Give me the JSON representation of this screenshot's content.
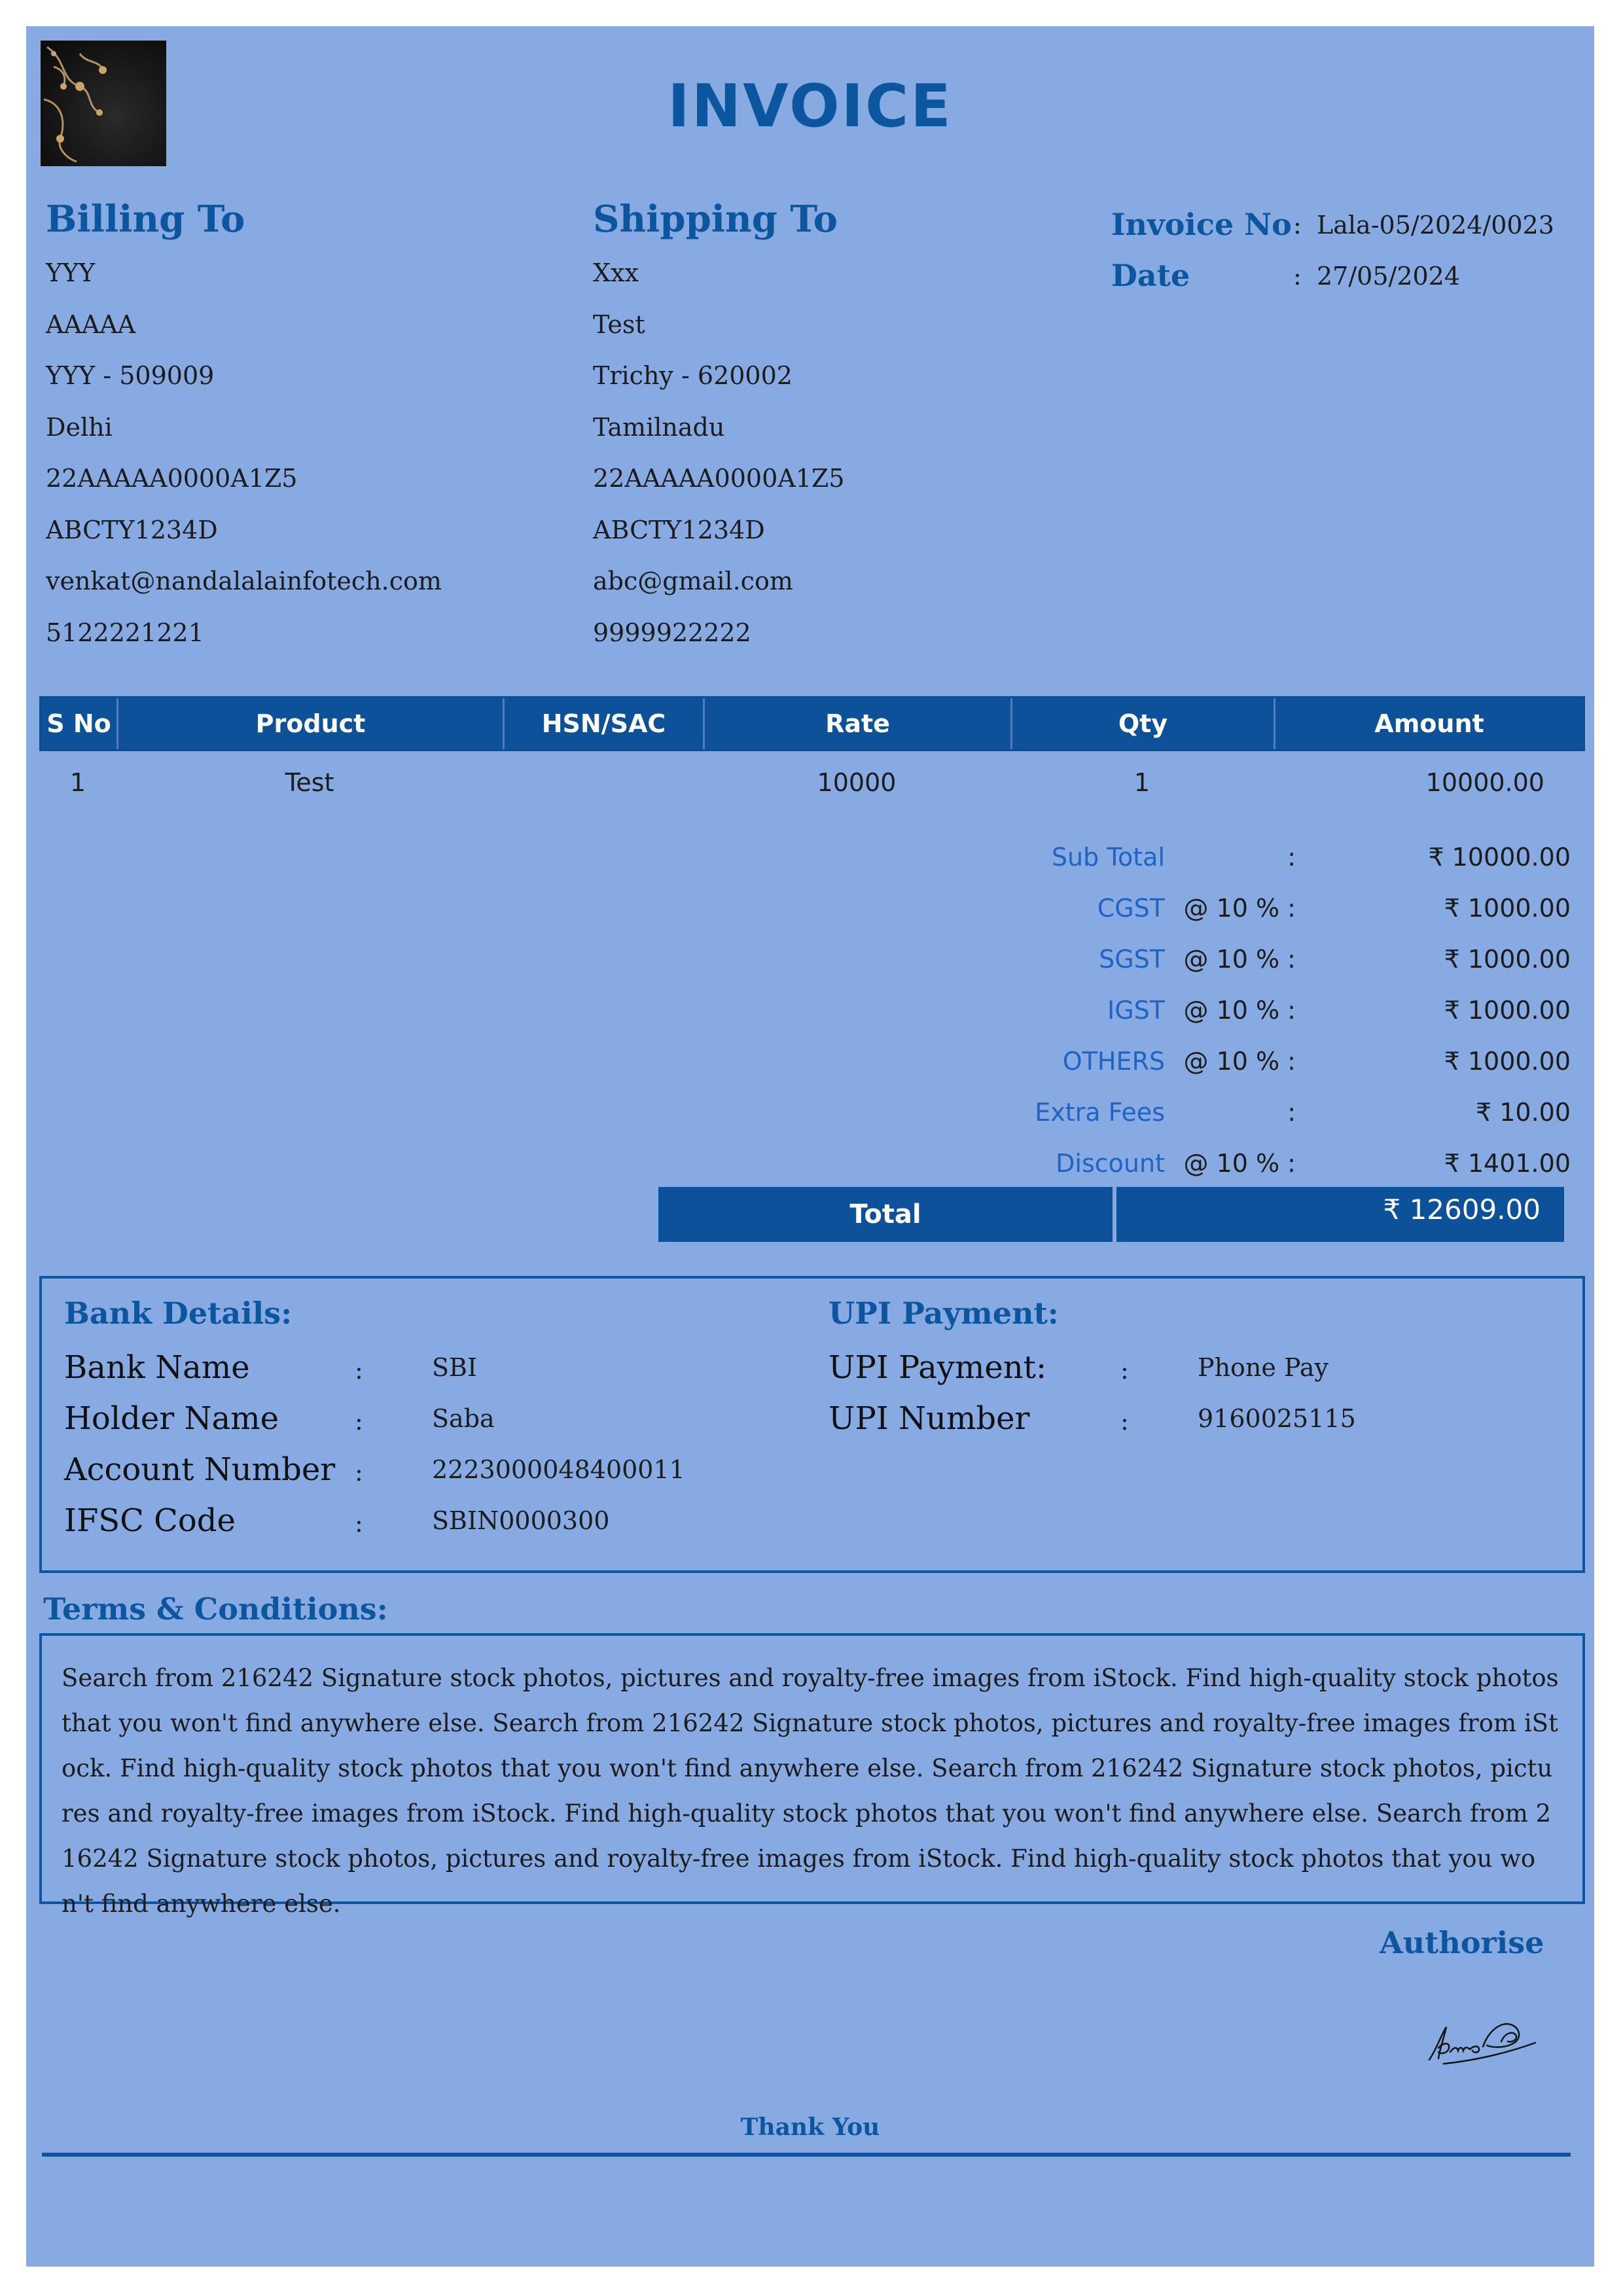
{
  "title": "INVOICE",
  "billing": {
    "heading": "Billing To",
    "lines": [
      "YYY",
      "AAAAA",
      "YYY - 509009",
      "Delhi",
      "22AAAAA0000A1Z5",
      "ABCTY1234D",
      "venkat@nandalalainfotech.com",
      "5122221221"
    ]
  },
  "shipping": {
    "heading": "Shipping To",
    "lines": [
      "Xxx",
      "Test",
      "Trichy - 620002",
      "Tamilnadu",
      "22AAAAA0000A1Z5",
      "ABCTY1234D",
      "abc@gmail.com",
      "9999922222"
    ]
  },
  "meta": {
    "invoice_no_label": "Invoice No",
    "invoice_no": "Lala-05/2024/0023",
    "date_label": "Date",
    "date": "27/05/2024",
    "colon": ":"
  },
  "table": {
    "headers": [
      "S No",
      "Product",
      "HSN/SAC",
      "Rate",
      "Qty",
      "Amount"
    ],
    "rows": [
      {
        "sno": "1",
        "product": "Test",
        "hsn": "",
        "rate": "10000",
        "qty": "1",
        "amount": "10000.00"
      }
    ]
  },
  "summary": [
    {
      "label": "Sub Total",
      "mid": ":",
      "value": "₹ 10000.00"
    },
    {
      "label": "CGST",
      "mid": "@ 10 % :",
      "value": "₹ 1000.00"
    },
    {
      "label": "SGST",
      "mid": "@ 10 % :",
      "value": "₹ 1000.00"
    },
    {
      "label": "IGST",
      "mid": "@ 10 % :",
      "value": "₹ 1000.00"
    },
    {
      "label": "OTHERS",
      "mid": "@ 10 % :",
      "value": "₹ 1000.00"
    },
    {
      "label": "Extra Fees",
      "mid": ":",
      "value": "₹ 10.00"
    },
    {
      "label": "Discount",
      "mid": "@ 10 % :",
      "value": "₹ 1401.00"
    }
  ],
  "total": {
    "label": "Total",
    "value": "₹ 12609.00"
  },
  "bank": {
    "heading": "Bank Details:",
    "rows": [
      {
        "label": "Bank Name",
        "value": "SBI"
      },
      {
        "label": "Holder Name",
        "value": "Saba"
      },
      {
        "label": "Account Number",
        "value": "2223000048400011"
      },
      {
        "label": "IFSC Code",
        "value": "SBIN0000300"
      }
    ]
  },
  "upi": {
    "heading": "UPI Payment:",
    "rows": [
      {
        "label": "UPI Payment:",
        "value": "Phone Pay"
      },
      {
        "label": "UPI Number",
        "value": "9160025115"
      }
    ]
  },
  "terms": {
    "heading": "Terms & Conditions:",
    "text": "Search from 216242 Signature stock photos, pictures and royalty-free images from iStock. Find high-quality stock photos that you won't find anywhere else. Search from 216242 Signature stock photos, pictures and royalty-free images from iStock. Find high-quality stock photos that you won't find anywhere else. Search from 216242 Signature stock photos, pictures and royalty-free images from iStock. Find high-quality stock photos that you won't find anywhere else. Search from 216242 Signature stock photos, pictures and royalty-free images from iStock. Find high-quality stock photos that you won't find anywhere else."
  },
  "authorise": "Authorise",
  "thank_you": "Thank You",
  "colors": {
    "page_bg": "#87aae2",
    "accent": "#0c56a0",
    "header_bar": "#0d519a",
    "summary_label": "#1f63c4"
  }
}
